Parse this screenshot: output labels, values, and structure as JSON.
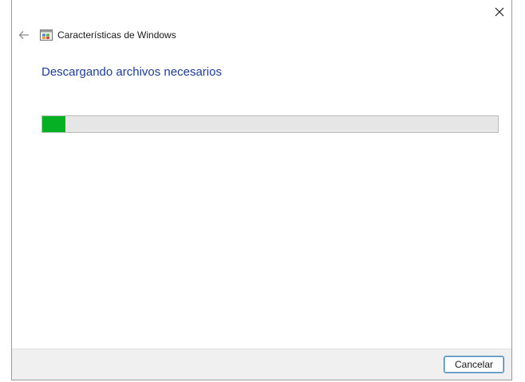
{
  "window": {
    "title": "Características de Windows",
    "title_icon": "windows-features-icon"
  },
  "controls": {
    "back_icon": "arrow-left-icon",
    "close_icon": "close-icon"
  },
  "content": {
    "main_instruction": "Descargando archivos necesarios",
    "progress": {
      "percent": 5,
      "color": "#06b025"
    }
  },
  "footer": {
    "cancel_label": "Cancelar"
  }
}
